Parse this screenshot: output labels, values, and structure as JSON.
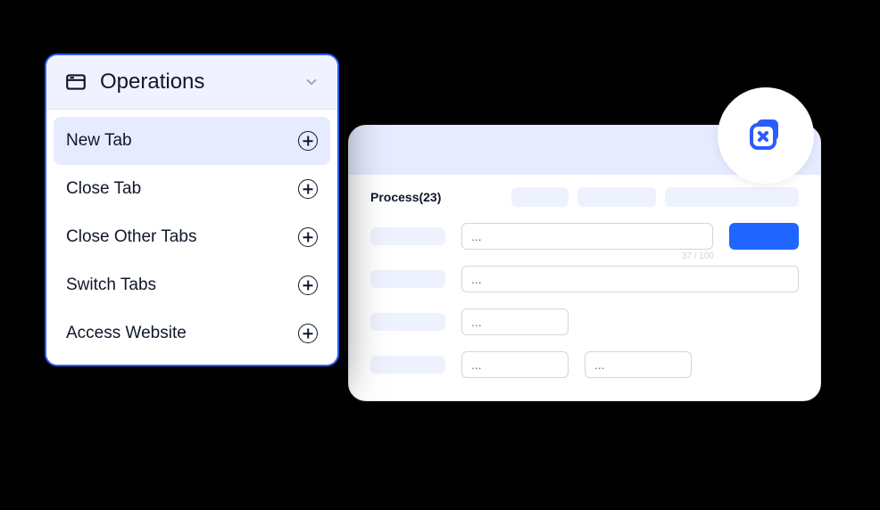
{
  "dropdown": {
    "title": "Operations",
    "items": [
      {
        "label": "New Tab",
        "active": true
      },
      {
        "label": "Close Tab",
        "active": false
      },
      {
        "label": "Close Other Tabs",
        "active": false
      },
      {
        "label": "Switch Tabs",
        "active": false
      },
      {
        "label": "Access Website",
        "active": false
      }
    ]
  },
  "panel": {
    "process_label": "Process(23)",
    "input_placeholder": "...",
    "counter": "37 / 100"
  },
  "colors": {
    "accent": "#2b5cff",
    "secondary": "#eef2ff"
  }
}
